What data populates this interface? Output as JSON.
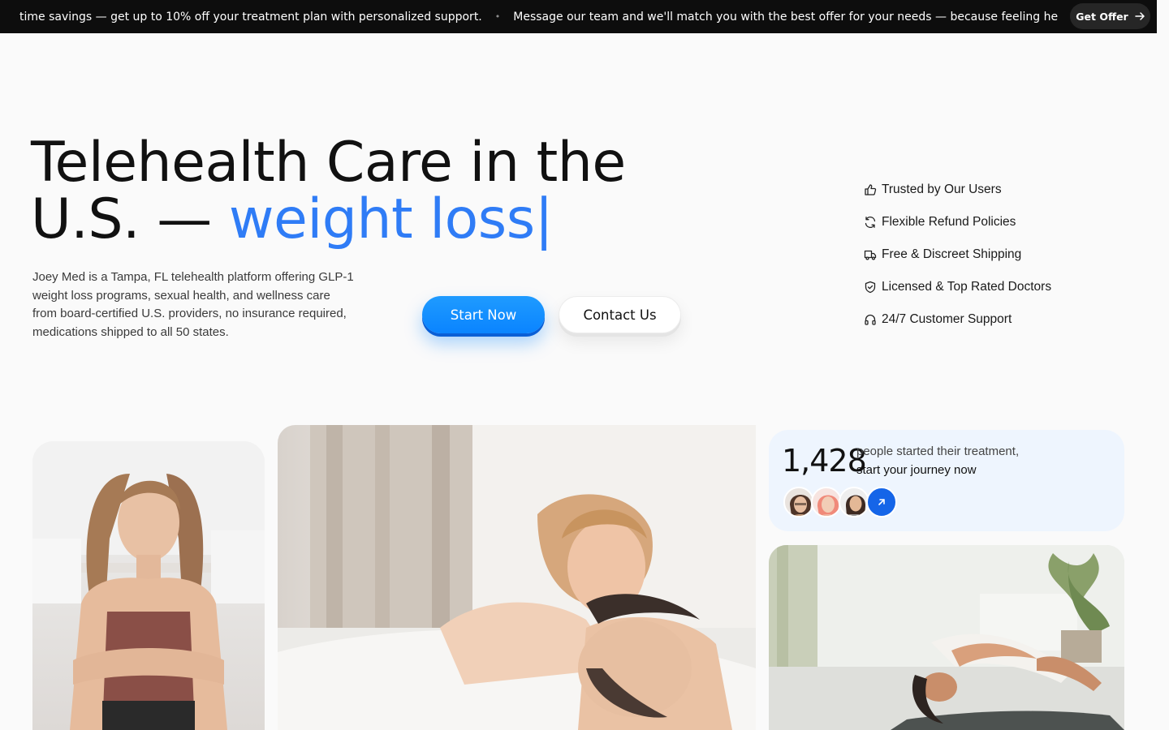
{
  "announcement": {
    "messages": [
      "time savings — get up to 10% off your treatment plan with personalized support.",
      "Message our team and we'll match you with the best offer for your needs — because feeling healthy should b"
    ],
    "separator": "•",
    "cta_label": "Get Offer"
  },
  "hero": {
    "title_main": "Telehealth Care in the U.S. — ",
    "title_accent": "weight loss|",
    "accent_color": "#2f7cf6",
    "description": "Joey Med is a Tampa, FL telehealth platform offering GLP-1 weight loss programs, sexual health, and wellness care from board-certified U.S. providers, no insurance required, medications shipped to all 50 states.",
    "start_label": "Start Now",
    "contact_label": "Contact Us"
  },
  "features": [
    {
      "icon": "thumbs-up-icon",
      "label": "Trusted by Our Users"
    },
    {
      "icon": "refresh-icon",
      "label": "Flexible Refund Policies"
    },
    {
      "icon": "truck-icon",
      "label": "Free & Discreet Shipping"
    },
    {
      "icon": "shield-check-icon",
      "label": "Licensed & Top Rated Doctors"
    },
    {
      "icon": "headphones-icon",
      "label": "24/7 Customer Support"
    }
  ],
  "stats": {
    "count": "1,428",
    "line1": "people started their treatment,",
    "line2": "start your journey now",
    "avatar_colors": [
      "#6b4b3a",
      "#f08a7a",
      "#3d2a22"
    ],
    "arrow_color": "#1565e8"
  }
}
